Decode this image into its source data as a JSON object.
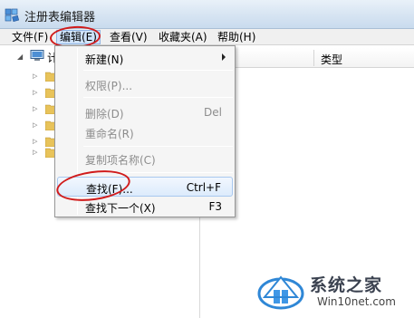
{
  "window": {
    "title": "注册表编辑器"
  },
  "menubar": {
    "items": [
      "文件(F)",
      "编辑(E)",
      "查看(V)",
      "收藏夹(A)",
      "帮助(H)"
    ],
    "active": "编辑(E)"
  },
  "tree": {
    "root_label": "计",
    "expander_glyph": "▷",
    "child_count_visible": 6
  },
  "list": {
    "columns": [
      "类型"
    ]
  },
  "edit_menu": {
    "items": [
      {
        "label": "新建(N)",
        "shortcut": "",
        "submenu": true,
        "enabled": true
      },
      {
        "label": "权限(P)...",
        "shortcut": "",
        "enabled": false
      },
      {
        "label": "删除(D)",
        "shortcut": "Del",
        "enabled": false
      },
      {
        "label": "重命名(R)",
        "shortcut": "",
        "enabled": false
      },
      {
        "label": "复制项名称(C)",
        "shortcut": "",
        "enabled": false
      },
      {
        "label": "查找(F)...",
        "shortcut": "Ctrl+F",
        "enabled": true,
        "highlighted": true
      },
      {
        "label": "查找下一个(X)",
        "shortcut": "F3",
        "enabled": true
      }
    ]
  },
  "watermark": {
    "title": "系统之家",
    "url": "Win10net.com"
  },
  "colors": {
    "annotation_red": "#d01b1b",
    "menu_highlight": "#cfe3fb",
    "folder_yellow": "#e8c35a"
  }
}
